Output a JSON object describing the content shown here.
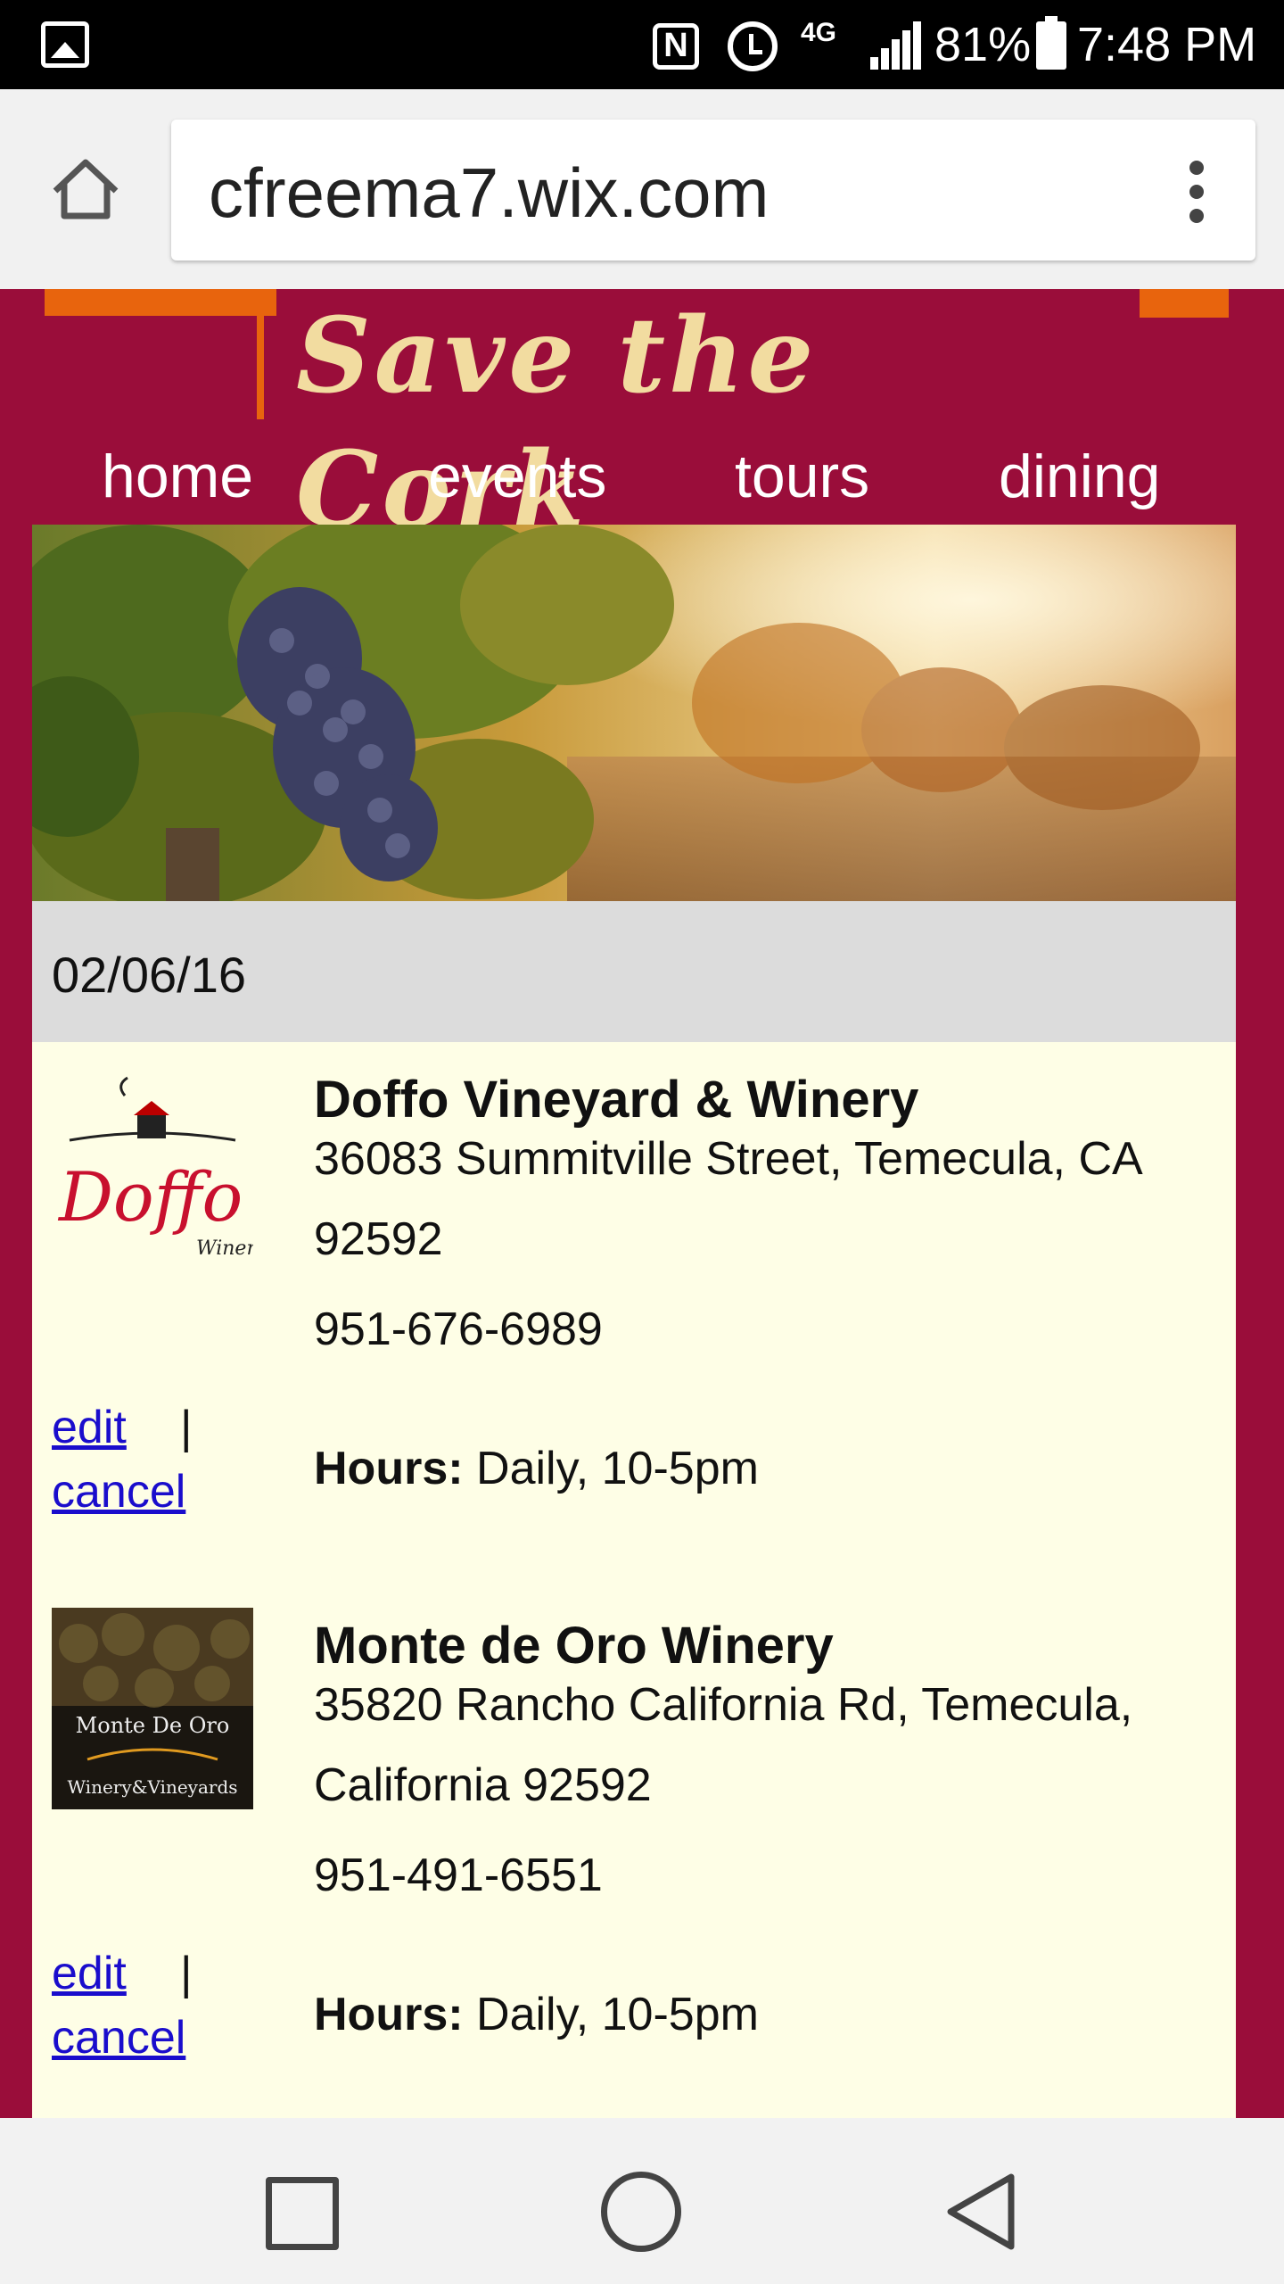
{
  "status_bar": {
    "network": "4G",
    "battery_pct": "81%",
    "time": "7:48 PM"
  },
  "browser": {
    "url": "cfreema7.wix.com"
  },
  "site": {
    "title": "Save the Cork",
    "nav": [
      "home",
      "events",
      "tours",
      "dining"
    ],
    "brand_color": "#9a0d3a",
    "accent_color": "#e8640d"
  },
  "content": {
    "date": "02/06/16",
    "wineries": [
      {
        "name": "Doffo Vineyard & Winery",
        "address": "36083 Summitville Street, Temecula, CA 92592",
        "phone": "951-676-6989",
        "hours_label": "Hours:",
        "hours": " Daily, 10-5pm",
        "edit": "edit",
        "separator": "|",
        "cancel": "cancel",
        "logo_text": "Doffo",
        "logo_subtext": "Winery"
      },
      {
        "name": "Monte de Oro Winery",
        "address": "35820 Rancho California Rd, Temecula, California 92592",
        "phone": "951-491-6551",
        "hours_label": "Hours:",
        "hours": " Daily, 10-5pm",
        "edit": "edit",
        "separator": "|",
        "cancel": "cancel",
        "logo_text": "Monte De Oro",
        "logo_subtext": "Winery&Vineyards"
      }
    ]
  }
}
